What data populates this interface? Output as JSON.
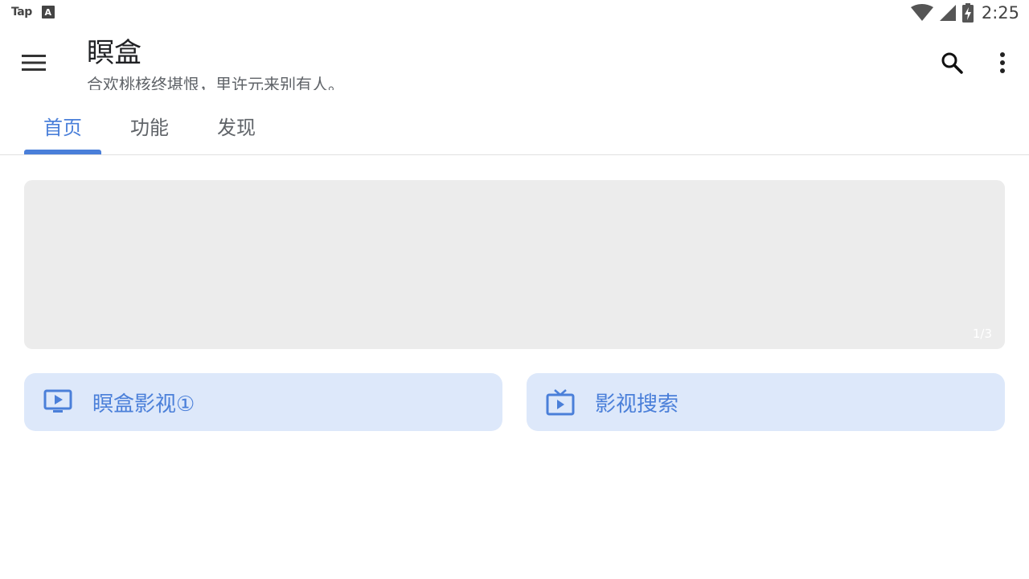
{
  "status_bar": {
    "app_label": "Tap",
    "keyboard_badge": "A",
    "time": "2:25",
    "icons": [
      "wifi-icon",
      "cell-signal-icon",
      "battery-charging-icon"
    ]
  },
  "app_bar": {
    "title": "瞑盒",
    "subtitle": "合欢桃核终堪恨，里许元来别有人。",
    "icons": [
      "menu-icon",
      "search-icon",
      "more-vert-icon"
    ]
  },
  "tabs": [
    {
      "label": "首页",
      "active": true
    },
    {
      "label": "功能",
      "active": false
    },
    {
      "label": "发现",
      "active": false
    }
  ],
  "banner": {
    "counter": "1/3"
  },
  "quick_actions": [
    {
      "label": "瞑盒影视①",
      "icon": "monitor-play-icon"
    },
    {
      "label": "影视搜索",
      "icon": "tv-play-icon"
    }
  ],
  "colors": {
    "accent": "#4a7fd9",
    "quick_action_bg": "#dde8fa",
    "banner_bg": "#ececec"
  }
}
